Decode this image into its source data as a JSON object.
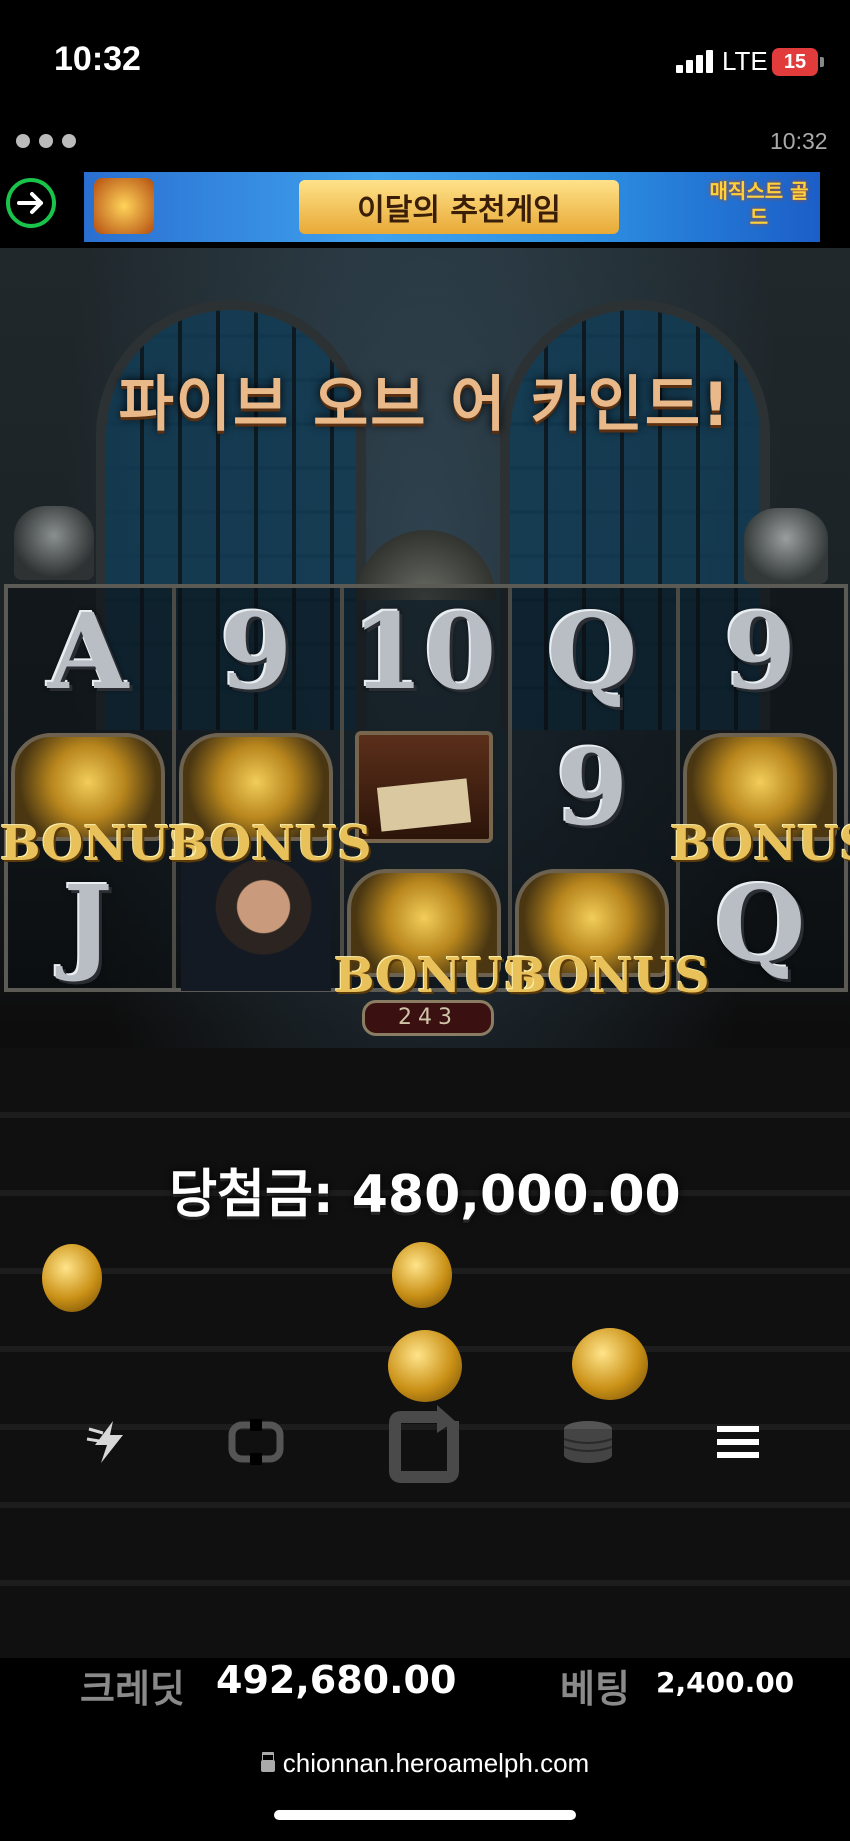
{
  "status_bar": {
    "time": "10:32",
    "network": "LTE",
    "battery": "15"
  },
  "browser": {
    "time": "10:32",
    "url": "chionnan.heroamelph.com"
  },
  "ad_banner": {
    "headline": "이달의 추천게임",
    "logo_text": "매직스트 골드"
  },
  "game": {
    "headline": "파이브 오브 어 카인드!",
    "reels": [
      [
        "A",
        "BONUS",
        "J"
      ],
      [
        "9",
        "BONUS",
        "hero"
      ],
      [
        "10",
        "scroll",
        "BONUS"
      ],
      [
        "Q",
        "9",
        "BONUS"
      ],
      [
        "9",
        "BONUS",
        "Q"
      ]
    ],
    "bonus_label": "BONUS",
    "ways": "243",
    "win_text": "당첨금: 480,000.00"
  },
  "controls": {
    "turbo": "lightning-icon",
    "autoplay": "repeat-icon",
    "spin": "spin-icon",
    "bet": "coins-icon",
    "menu": "menu-icon"
  },
  "footer": {
    "credit_label": "크레딧",
    "credit_value": "492,680.00",
    "bet_label": "베팅",
    "bet_value": "2,400.00"
  },
  "colors": {
    "headline": "#e9b98a",
    "bonus": "#e8c15a",
    "accent_green": "#19c44a"
  }
}
